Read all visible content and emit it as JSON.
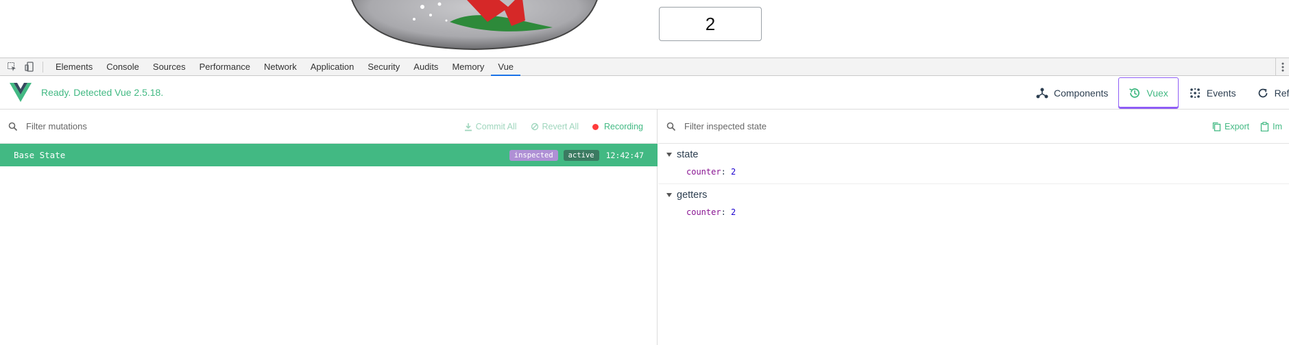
{
  "page": {
    "counter_value": "2"
  },
  "devtools": {
    "tabs": [
      "Elements",
      "Console",
      "Sources",
      "Performance",
      "Network",
      "Application",
      "Security",
      "Audits",
      "Memory",
      "Vue"
    ],
    "active_tab": "Vue"
  },
  "vue": {
    "status": "Ready. Detected Vue 2.5.18.",
    "nav": {
      "components": "Components",
      "vuex": "Vuex",
      "events": "Events",
      "refresh": "Ref"
    },
    "accent_color": "#42b983",
    "active_nav_border_color": "#8e5cf6"
  },
  "mutations": {
    "filter_placeholder": "Filter mutations",
    "commit_all": "Commit All",
    "revert_all": "Revert All",
    "recording": "Recording",
    "base_state": {
      "label": "Base State",
      "tag_inspected": "inspected",
      "tag_active": "active",
      "time": "12:42:47"
    }
  },
  "state_inspector": {
    "filter_placeholder": "Filter inspected state",
    "export": "Export",
    "import": "Im",
    "sections": [
      {
        "title": "state",
        "key": "counter",
        "value": "2"
      },
      {
        "title": "getters",
        "key": "counter",
        "value": "2"
      }
    ]
  }
}
